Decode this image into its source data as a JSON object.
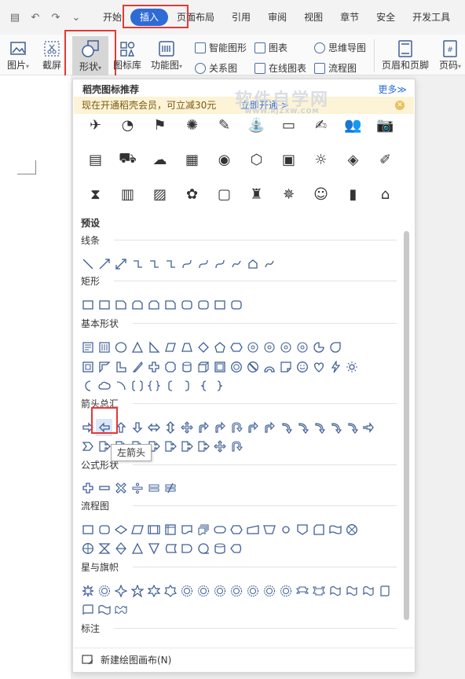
{
  "menubar": {
    "tabs": [
      "开始",
      "插入",
      "页面布局",
      "引用",
      "审阅",
      "视图",
      "章节",
      "安全",
      "开发工具"
    ],
    "active_tab": "插入"
  },
  "ribbon": {
    "picture": "图片",
    "screenshot": "截屏",
    "shapes": "形状",
    "icon_library": "图标库",
    "function_chart": "功能图",
    "smart_art": "智能图形",
    "chart": "图表",
    "mind_map": "思维导图",
    "relation_chart": "关系图",
    "online_chart": "在线图表",
    "flowchart": "流程图",
    "header_footer": "页眉和页脚",
    "page_number": "页码"
  },
  "panel": {
    "header": "稻壳图标推荐",
    "more": "更多≫",
    "promo_text": "现在开通稻壳会员，可立减30元",
    "promo_link": "立即开通 >",
    "watermark": "软件自学网",
    "watermark_url": "WWW.RJZXW.COM",
    "presets_title": "预设",
    "sections": {
      "lines": "线条",
      "rect": "矩形",
      "basic": "基本形状",
      "arrows": "箭头总汇",
      "formula": "公式形状",
      "flowchart": "流程图",
      "stars": "星与旗帜",
      "callouts": "标注"
    },
    "tooltip": "左箭头",
    "new_canvas": "新建绘图画布(N)"
  },
  "icons": [
    "✈",
    "◔",
    "⚑",
    "✺",
    "✎",
    "⛲",
    "▭",
    "✍",
    "👥",
    "📷",
    "▤",
    "⛟",
    "☁",
    "▦",
    "◉",
    "⬡",
    "▣",
    "☼",
    "◈",
    "✐",
    "⧗",
    "▥",
    "▨",
    "✿",
    "▢",
    "♜",
    "✵",
    "☺",
    "▮",
    "⌂"
  ],
  "colors": {
    "accent": "#2e6bd6",
    "shape_stroke": "#3e5f95",
    "highlight_box": "#e53935"
  }
}
